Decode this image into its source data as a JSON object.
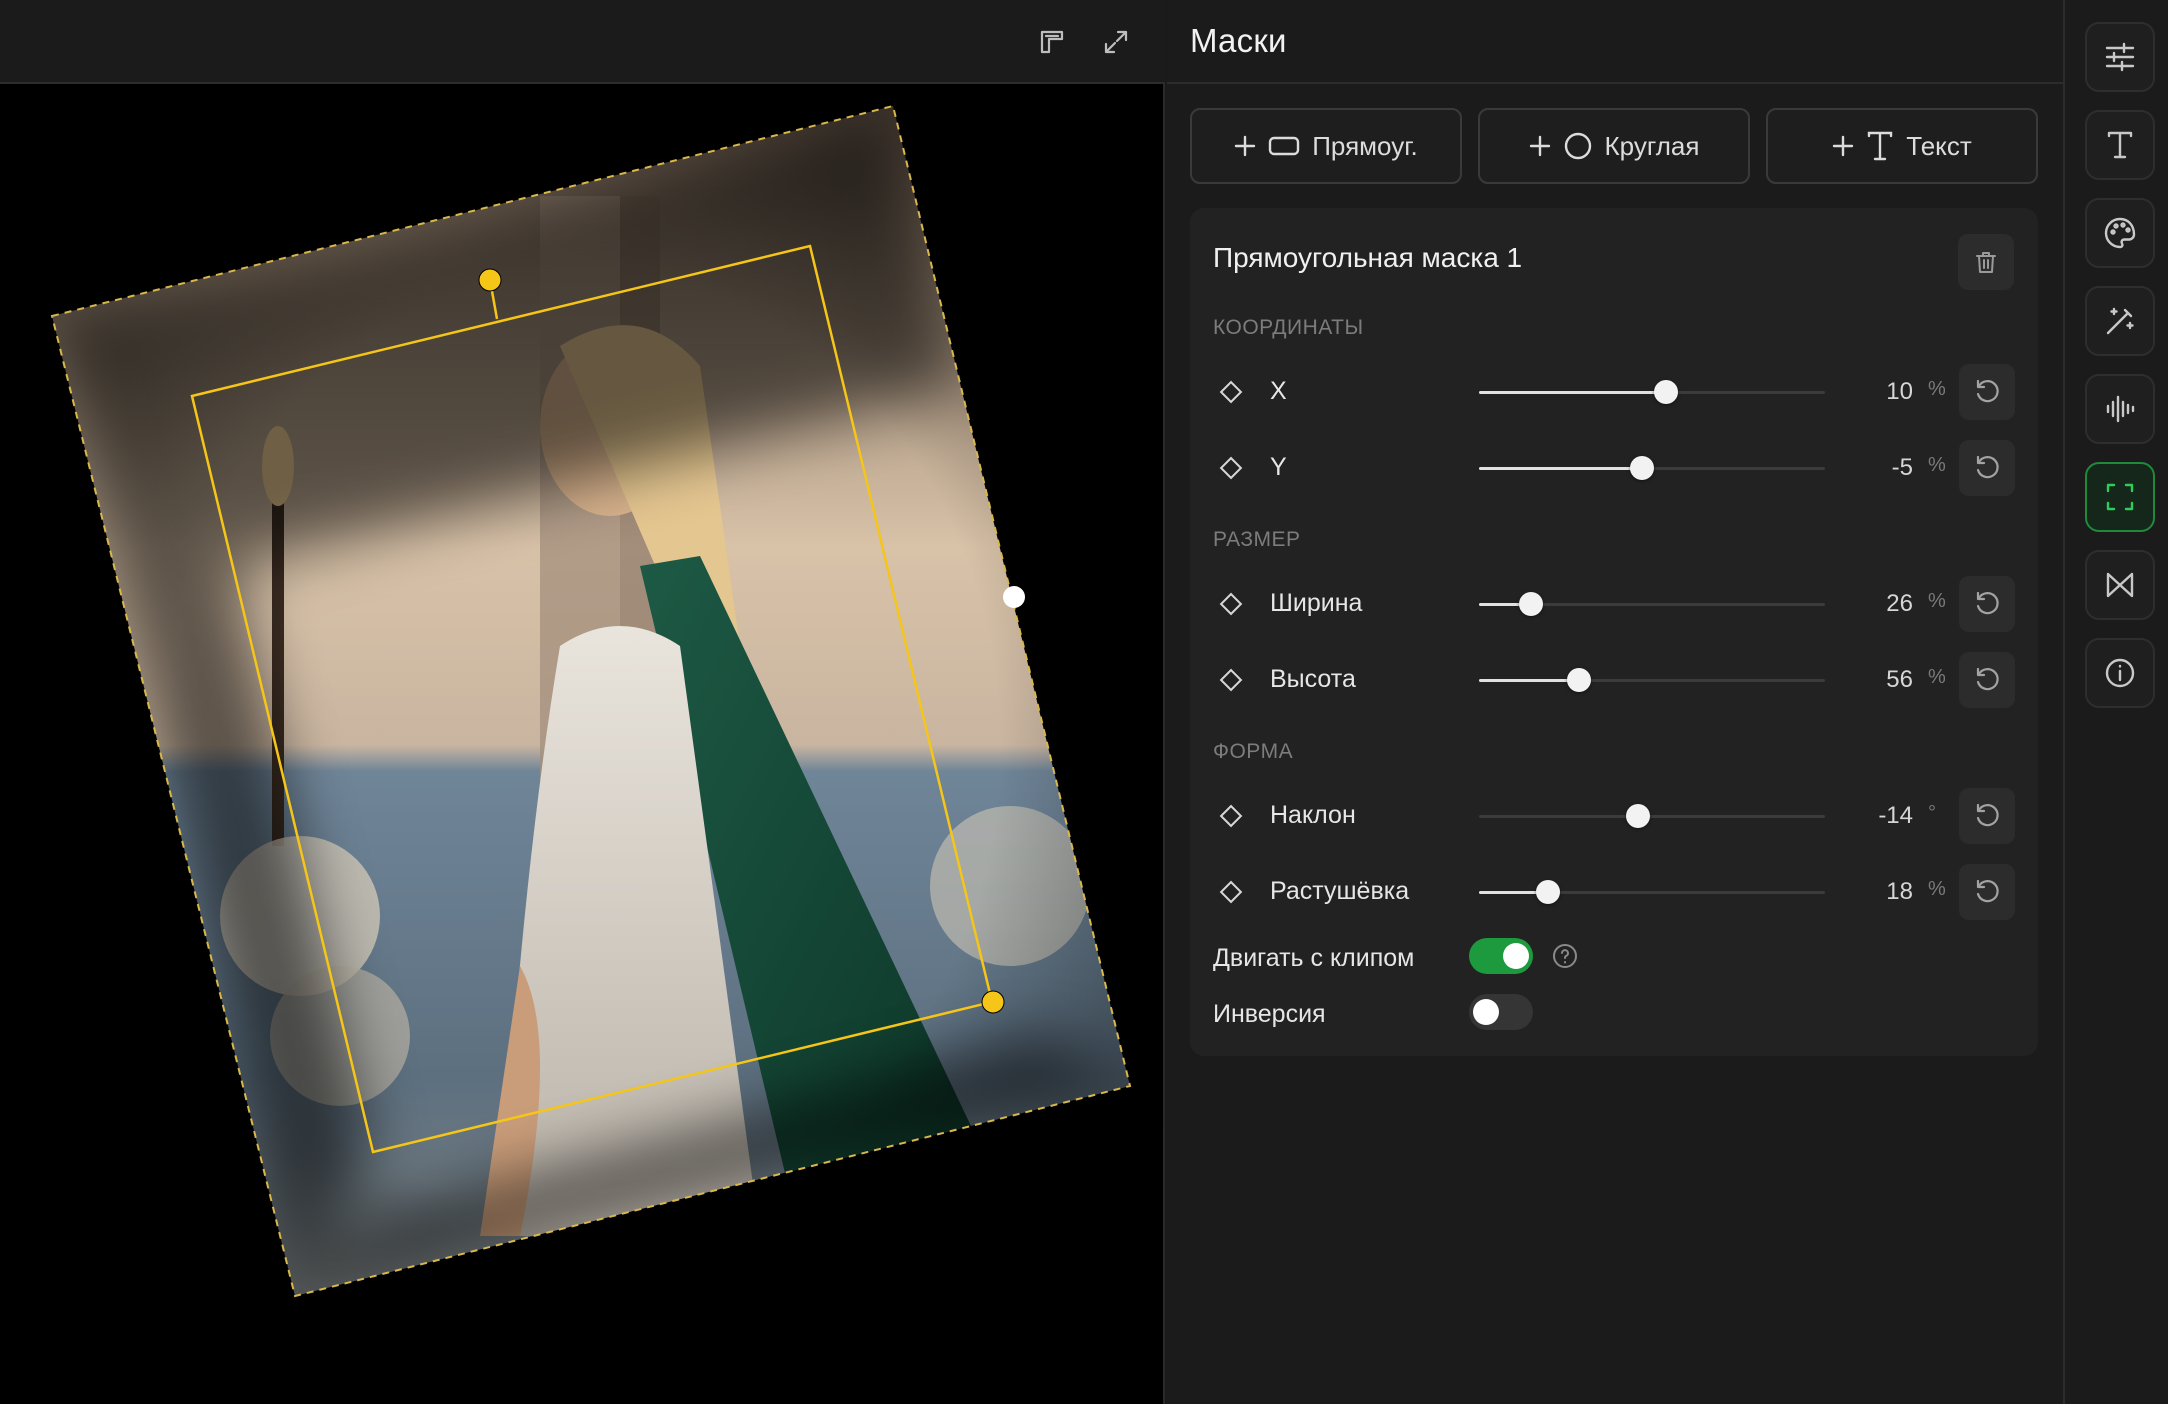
{
  "panel": {
    "title": "Маски",
    "add_buttons": [
      {
        "label": "Прямоуг.",
        "icon": "rectangle-icon"
      },
      {
        "label": "Круглая",
        "icon": "circle-icon"
      },
      {
        "label": "Текст",
        "icon": "text-icon"
      }
    ],
    "mask": {
      "title": "Прямоугольная маска 1",
      "sections": {
        "coords": "КООРДИНАТЫ",
        "size": "РАЗМЕР",
        "shape": "ФОРМА"
      },
      "params": {
        "x": {
          "label": "X",
          "value": "10",
          "unit": "%",
          "level": 0.54
        },
        "y": {
          "label": "Y",
          "value": "-5",
          "unit": "%",
          "level": 0.47
        },
        "width": {
          "label": "Ширина",
          "value": "26",
          "unit": "%",
          "level": 0.15
        },
        "height": {
          "label": "Высота",
          "value": "56",
          "unit": "%",
          "level": 0.29
        },
        "tilt": {
          "label": "Наклон",
          "value": "-14",
          "unit": "°",
          "level": 0.46
        },
        "feather": {
          "label": "Растушёвка",
          "value": "18",
          "unit": "%",
          "level": 0.2
        }
      },
      "toggles": {
        "move_with_clip": {
          "label": "Двигать с клипом",
          "on": true
        },
        "inverse": {
          "label": "Инверсия",
          "on": false
        }
      }
    }
  },
  "rail": {
    "items": [
      "sliders-icon",
      "text-tool-icon",
      "palette-icon",
      "magic-wand-icon",
      "audio-wave-icon",
      "mask-frame-icon",
      "transition-icon",
      "info-icon"
    ],
    "active": "mask-frame-icon"
  },
  "colors": {
    "accent_green": "#1e9a3e",
    "mask_handle_yellow": "#f5c518",
    "background": "#1a1a1a"
  }
}
